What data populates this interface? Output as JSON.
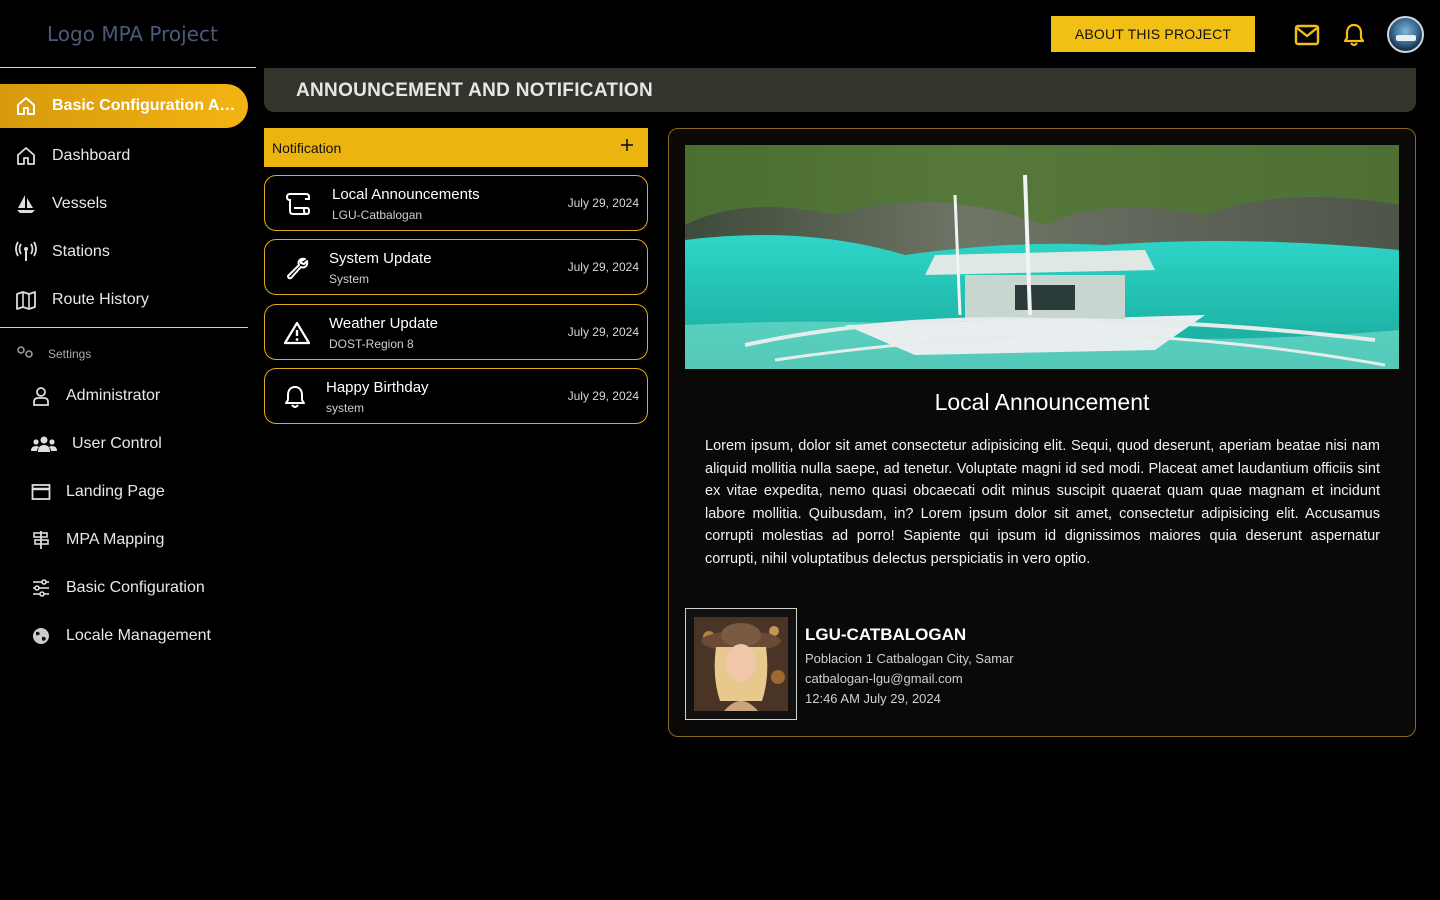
{
  "app": {
    "logo_text": "Logo MPA Project",
    "about_button": "ABOUT THIS PROJECT",
    "accent_color": "#f2c014"
  },
  "sidebar": {
    "active_item": {
      "label": "Basic Configuration Act...",
      "icon": "home-icon"
    },
    "items": [
      {
        "label": "Dashboard",
        "icon": "home-icon"
      },
      {
        "label": "Vessels",
        "icon": "sailboat-icon"
      },
      {
        "label": "Stations",
        "icon": "antenna-icon"
      },
      {
        "label": "Route History",
        "icon": "map-icon"
      }
    ],
    "settings_label": "Settings",
    "settings_items": [
      {
        "label": "Administrator",
        "icon": "user-icon"
      },
      {
        "label": "User Control",
        "icon": "users-icon"
      },
      {
        "label": "Landing Page",
        "icon": "window-icon"
      },
      {
        "label": "MPA Mapping",
        "icon": "signpost-icon"
      },
      {
        "label": "Basic Configuration",
        "icon": "sliders-icon"
      },
      {
        "label": "Locale Management",
        "icon": "globe-icon"
      }
    ]
  },
  "page": {
    "title": "ANNOUNCEMENT AND NOTIFICATION"
  },
  "notifications": {
    "header_label": "Notification",
    "items": [
      {
        "title": "Local Announcements",
        "source": "LGU-Catbalogan",
        "date": "July 29, 2024",
        "icon": "scroll-icon"
      },
      {
        "title": "System Update",
        "source": "System",
        "date": "July 29, 2024",
        "icon": "wrench-icon"
      },
      {
        "title": "Weather Update",
        "source": "DOST-Region 8",
        "date": "July 29, 2024",
        "icon": "warning-icon"
      },
      {
        "title": "Happy Birthday",
        "source": "system",
        "date": "July 29, 2024",
        "icon": "bell-icon"
      }
    ]
  },
  "detail": {
    "title": "Local Announcement",
    "body": "Lorem ipsum, dolor sit amet consectetur adipisicing elit. Sequi, quod deserunt, aperiam beatae nisi nam aliquid mollitia nulla saepe, ad tenetur. Voluptate magni id sed modi. Placeat amet laudantium officiis sint ex vitae expedita, nemo quasi obcaecati odit minus suscipit quaerat quam quae magnam et incidunt labore mollitia. Quibusdam, in? Lorem ipsum dolor sit amet, consectetur adipisicing elit. Accusamus corrupti molestias ad porro! Sapiente qui ipsum id dignissimos maiores quia deserunt aspernatur corrupti, nihil voluptatibus delectus perspiciatis in vero optio.",
    "author": {
      "name": "LGU-CATBALOGAN",
      "address": "Poblacion 1 Catbalogan City, Samar",
      "email": "catbalogan-lgu@gmail.com",
      "timestamp": "12:46 AM July 29, 2024"
    }
  }
}
